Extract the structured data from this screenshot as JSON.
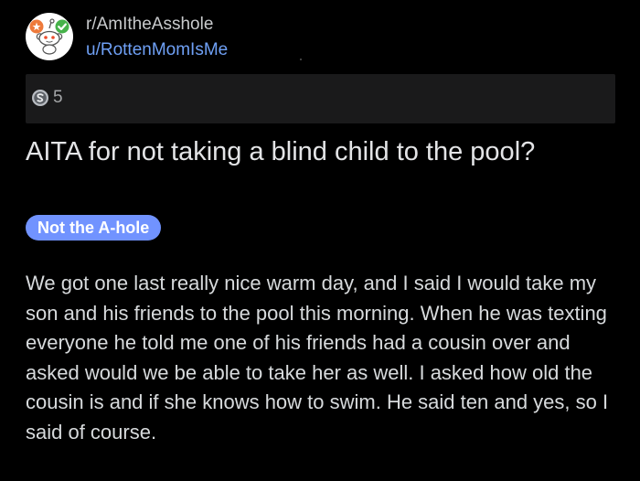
{
  "colors": {
    "background": "#000000",
    "link_blue": "#6fa0f5",
    "flair_bg": "#7193ff",
    "award_bar_bg": "#1a1a1b"
  },
  "post": {
    "subreddit": "r/AmItheAsshole",
    "author": "u/RottenMomIsMe",
    "avatar_icon": "snoo-avatar-icon",
    "award_icon": "silver-award-icon",
    "award_count": "5",
    "title": "AITA for not taking a blind child to the pool?",
    "flair": "Not the A-hole",
    "body": "We got one last really nice warm day, and I said I would take my son and his friends to the pool this morning. When he was texting everyone he told me one of his friends had a cousin over and asked would we be able to take her as well. I asked how old the cousin is and if she knows how to swim. He said ten and yes, so I said of course."
  }
}
